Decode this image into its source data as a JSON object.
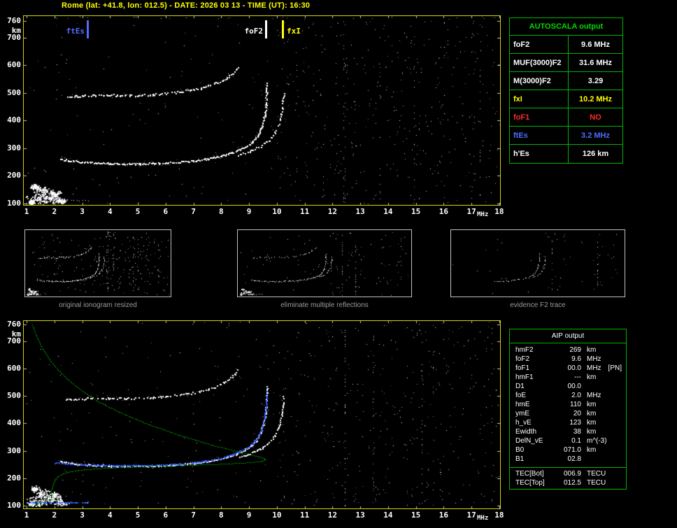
{
  "header": {
    "title": "Rome (lat: +41.8, lon: 012.5) - DATE: 2026 03 13 - TIME (UT): 16:30"
  },
  "autoscala": {
    "title": "AUTOSCALA output",
    "rows": [
      {
        "label": "foF2",
        "value": "9.6 MHz",
        "color": "#ffffff"
      },
      {
        "label": "MUF(3000)F2",
        "value": "31.6 MHz",
        "color": "#ffffff"
      },
      {
        "label": "M(3000)F2",
        "value": "3.29",
        "color": "#ffffff"
      },
      {
        "label": "fxI",
        "value": "10.2 MHz",
        "color": "#ffff00"
      },
      {
        "label": "foF1",
        "value": "NO",
        "color": "#ff2a2a"
      },
      {
        "label": "ftEs",
        "value": "3.2 MHz",
        "color": "#4f6dff"
      },
      {
        "label": "h'Es",
        "value": "126  km",
        "color": "#ffffff"
      }
    ]
  },
  "aip": {
    "title": "AIP output",
    "rows": [
      {
        "label": "hmF2",
        "value": "269",
        "unit": "km",
        "extra": ""
      },
      {
        "label": "foF2",
        "value": "9.6",
        "unit": "MHz",
        "extra": ""
      },
      {
        "label": "foF1",
        "value": "00.0",
        "unit": "MHz",
        "extra": "[PN]"
      },
      {
        "label": "hmF1",
        "value": "---",
        "unit": "km",
        "extra": ""
      },
      {
        "label": "D1",
        "value": "00.0",
        "unit": "",
        "extra": ""
      },
      {
        "label": "foE",
        "value": "2.0",
        "unit": "MHz",
        "extra": ""
      },
      {
        "label": "hmE",
        "value": "110",
        "unit": "km",
        "extra": ""
      },
      {
        "label": "ymE",
        "value": "20",
        "unit": "km",
        "extra": ""
      },
      {
        "label": "h_vE",
        "value": "123",
        "unit": "km",
        "extra": ""
      },
      {
        "label": "Ewidth",
        "value": "38",
        "unit": "km",
        "extra": ""
      },
      {
        "label": "DelN_vE",
        "value": "0.1",
        "unit": "m^(-3)",
        "extra": ""
      },
      {
        "label": "B0",
        "value": "071.0",
        "unit": "km",
        "extra": ""
      },
      {
        "label": "B1",
        "value": "02.8",
        "unit": "",
        "extra": ""
      }
    ],
    "tec_rows": [
      {
        "label": "TEC[Bot]",
        "value": "006.9",
        "unit": "TECU"
      },
      {
        "label": "TEC[Top]",
        "value": "012.5",
        "unit": "TECU"
      }
    ]
  },
  "mini_panels": [
    {
      "caption": "original ionogram resized"
    },
    {
      "caption": "eliminate multiple reflections"
    },
    {
      "caption": "evidence F2 trace"
    }
  ],
  "chart_data": [
    {
      "id": "top_ionogram_autoscaled",
      "type": "scatter",
      "xlabel": "MHz",
      "ylabel": "km",
      "xlim": [
        1,
        18
      ],
      "ylim": [
        100,
        760
      ],
      "x_ticks": [
        1,
        2,
        3,
        4,
        5,
        6,
        7,
        8,
        9,
        10,
        11,
        12,
        13,
        14,
        15,
        16,
        17,
        18
      ],
      "y_ticks": [
        760,
        700,
        600,
        500,
        400,
        300,
        200,
        100
      ],
      "markers": [
        {
          "label": "ftEs",
          "freq_mhz": 3.2,
          "color": "#4f6dff",
          "side": "left"
        },
        {
          "label": "foF2",
          "freq_mhz": 9.6,
          "color": "#ffffff",
          "side": "left"
        },
        {
          "label": "fxI",
          "freq_mhz": 10.2,
          "color": "#ffff00",
          "side": "right"
        }
      ],
      "series": {
        "es_cloud": [
          [
            1.35,
            118,
            0.35,
            16
          ],
          [
            1.8,
            122,
            0.3,
            18
          ],
          [
            2.2,
            112,
            0.22,
            10
          ],
          [
            1.55,
            145,
            0.28,
            16
          ],
          [
            1.3,
            162,
            0.14,
            10
          ],
          [
            2.0,
            138,
            0.22,
            12
          ],
          [
            1.15,
            106,
            0.12,
            6
          ]
        ],
        "es_tail": [
          [
            1.0,
            111
          ],
          [
            3.2,
            110
          ]
        ],
        "f_trace_o": [
          [
            2.2,
            262
          ],
          [
            2.6,
            255
          ],
          [
            3.0,
            251
          ],
          [
            3.5,
            248
          ],
          [
            4.0,
            246
          ],
          [
            4.5,
            245
          ],
          [
            5.0,
            245
          ],
          [
            5.5,
            246
          ],
          [
            6.0,
            248
          ],
          [
            6.5,
            251
          ],
          [
            7.0,
            256
          ],
          [
            7.5,
            263
          ],
          [
            8.0,
            273
          ],
          [
            8.4,
            285
          ],
          [
            8.8,
            302
          ],
          [
            9.1,
            322
          ],
          [
            9.3,
            347
          ],
          [
            9.45,
            377
          ],
          [
            9.55,
            417
          ],
          [
            9.6,
            460
          ],
          [
            9.62,
            505
          ],
          [
            9.63,
            535
          ]
        ],
        "f_trace_x": [
          [
            8.6,
            278
          ],
          [
            9.0,
            290
          ],
          [
            9.4,
            308
          ],
          [
            9.7,
            330
          ],
          [
            9.9,
            354
          ],
          [
            10.05,
            384
          ],
          [
            10.15,
            422
          ],
          [
            10.2,
            464
          ],
          [
            10.23,
            502
          ]
        ],
        "second_order": [
          [
            2.4,
            487
          ],
          [
            3.0,
            491
          ],
          [
            3.5,
            493
          ],
          [
            4.0,
            493
          ],
          [
            4.5,
            492
          ],
          [
            5.0,
            493
          ],
          [
            5.5,
            495
          ],
          [
            6.0,
            499
          ],
          [
            6.5,
            505
          ],
          [
            7.0,
            513
          ],
          [
            7.5,
            525
          ],
          [
            8.0,
            543
          ],
          [
            8.3,
            562
          ],
          [
            8.5,
            582
          ],
          [
            8.6,
            598
          ]
        ]
      }
    },
    {
      "id": "bottom_ionogram_profile",
      "type": "scatter",
      "xlabel": "MHz",
      "ylabel": "km",
      "xlim": [
        1,
        18
      ],
      "ylim": [
        100,
        760
      ],
      "x_ticks": [
        1,
        2,
        3,
        4,
        5,
        6,
        7,
        8,
        9,
        10,
        11,
        12,
        13,
        14,
        15,
        16,
        17,
        18
      ],
      "y_ticks": [
        760,
        700,
        600,
        500,
        400,
        300,
        200,
        100
      ],
      "markers": [],
      "series": {
        "es_cloud": [
          [
            1.35,
            118,
            0.35,
            16
          ],
          [
            1.8,
            122,
            0.3,
            18
          ],
          [
            2.2,
            112,
            0.22,
            10
          ],
          [
            1.55,
            145,
            0.28,
            16
          ],
          [
            1.3,
            162,
            0.14,
            10
          ],
          [
            2.0,
            138,
            0.22,
            12
          ],
          [
            1.15,
            106,
            0.12,
            6
          ]
        ],
        "es_tail": [
          [
            1.0,
            111
          ],
          [
            3.2,
            110
          ]
        ],
        "f_trace_o": [
          [
            2.2,
            262
          ],
          [
            2.6,
            255
          ],
          [
            3.0,
            251
          ],
          [
            3.5,
            248
          ],
          [
            4.0,
            246
          ],
          [
            4.5,
            245
          ],
          [
            5.0,
            245
          ],
          [
            5.5,
            246
          ],
          [
            6.0,
            248
          ],
          [
            6.5,
            251
          ],
          [
            7.0,
            256
          ],
          [
            7.5,
            263
          ],
          [
            8.0,
            273
          ],
          [
            8.4,
            285
          ],
          [
            8.8,
            302
          ],
          [
            9.1,
            322
          ],
          [
            9.3,
            347
          ],
          [
            9.45,
            377
          ],
          [
            9.55,
            417
          ],
          [
            9.6,
            460
          ],
          [
            9.62,
            505
          ],
          [
            9.63,
            535
          ]
        ],
        "f_trace_x": [
          [
            8.6,
            278
          ],
          [
            9.0,
            290
          ],
          [
            9.4,
            308
          ],
          [
            9.7,
            330
          ],
          [
            9.9,
            354
          ],
          [
            10.05,
            384
          ],
          [
            10.15,
            422
          ],
          [
            10.2,
            464
          ],
          [
            10.23,
            502
          ]
        ],
        "second_order": [
          [
            2.4,
            487
          ],
          [
            3.0,
            491
          ],
          [
            3.5,
            493
          ],
          [
            4.0,
            493
          ],
          [
            4.5,
            492
          ],
          [
            5.0,
            493
          ],
          [
            5.5,
            495
          ],
          [
            6.0,
            499
          ],
          [
            6.5,
            505
          ],
          [
            7.0,
            513
          ],
          [
            7.5,
            525
          ],
          [
            8.0,
            543
          ],
          [
            8.3,
            562
          ],
          [
            8.5,
            582
          ],
          [
            8.6,
            598
          ]
        ],
        "autoscaled_trace_es": [
          [
            1.0,
            113
          ],
          [
            3.2,
            113
          ]
        ],
        "autoscaled_trace_f": [
          [
            2.0,
            258
          ],
          [
            2.5,
            254
          ],
          [
            3.0,
            251
          ],
          [
            3.5,
            249
          ],
          [
            4.0,
            248
          ],
          [
            4.5,
            247
          ],
          [
            5.0,
            247
          ],
          [
            5.5,
            248
          ],
          [
            6.0,
            250
          ],
          [
            6.5,
            253
          ],
          [
            7.0,
            258
          ],
          [
            7.5,
            265
          ],
          [
            8.0,
            275
          ],
          [
            8.4,
            288
          ],
          [
            8.8,
            305
          ],
          [
            9.1,
            325
          ],
          [
            9.3,
            350
          ],
          [
            9.45,
            382
          ],
          [
            9.55,
            425
          ],
          [
            9.6,
            468
          ],
          [
            9.62,
            500
          ],
          [
            9.63,
            520
          ]
        ],
        "electron_density_profile": [
          [
            1.2,
            760
          ],
          [
            1.35,
            718
          ],
          [
            1.55,
            676
          ],
          [
            1.8,
            636
          ],
          [
            2.1,
            598
          ],
          [
            2.5,
            558
          ],
          [
            3.0,
            518
          ],
          [
            3.6,
            478
          ],
          [
            4.4,
            438
          ],
          [
            5.3,
            400
          ],
          [
            6.4,
            360
          ],
          [
            7.7,
            320
          ],
          [
            8.9,
            290
          ],
          [
            9.45,
            276
          ],
          [
            9.6,
            269
          ],
          [
            9.4,
            261
          ],
          [
            8.8,
            256
          ],
          [
            7.8,
            251
          ],
          [
            6.5,
            247
          ],
          [
            5.2,
            243
          ],
          [
            4.0,
            238
          ],
          [
            3.1,
            232
          ],
          [
            2.6,
            225
          ],
          [
            2.3,
            216
          ],
          [
            2.1,
            204
          ],
          [
            2.0,
            191
          ],
          [
            1.95,
            176
          ],
          [
            1.9,
            160
          ],
          [
            1.87,
            147
          ],
          [
            1.92,
            137
          ],
          [
            2.0,
            129
          ],
          [
            1.93,
            123
          ],
          [
            1.72,
            118
          ],
          [
            1.45,
            112
          ],
          [
            1.25,
            106
          ],
          [
            1.1,
            100
          ]
        ]
      }
    }
  ]
}
